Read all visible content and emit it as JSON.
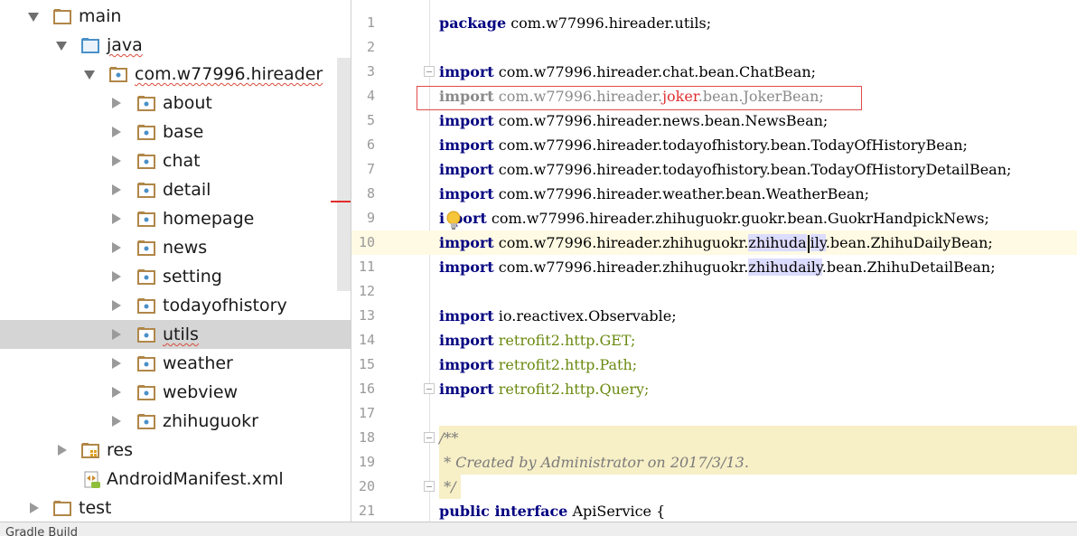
{
  "tree": {
    "nodes": [
      {
        "label": "main",
        "type": "folder",
        "expanded": true
      },
      {
        "label": "java",
        "type": "source-root",
        "expanded": true
      },
      {
        "label": "com.w77996.hireader",
        "type": "package",
        "expanded": true
      },
      {
        "label": "about",
        "type": "package",
        "expanded": false
      },
      {
        "label": "base",
        "type": "package",
        "expanded": false
      },
      {
        "label": "chat",
        "type": "package",
        "expanded": false
      },
      {
        "label": "detail",
        "type": "package",
        "expanded": false
      },
      {
        "label": "homepage",
        "type": "package",
        "expanded": false
      },
      {
        "label": "news",
        "type": "package",
        "expanded": false
      },
      {
        "label": "setting",
        "type": "package",
        "expanded": false
      },
      {
        "label": "todayofhistory",
        "type": "package",
        "expanded": false
      },
      {
        "label": "utils",
        "type": "package",
        "expanded": false,
        "selected": true
      },
      {
        "label": "weather",
        "type": "package",
        "expanded": false
      },
      {
        "label": "webview",
        "type": "package",
        "expanded": false
      },
      {
        "label": "zhihuguokr",
        "type": "package",
        "expanded": false
      },
      {
        "label": "res",
        "type": "resource-folder",
        "expanded": false
      },
      {
        "label": "AndroidManifest.xml",
        "type": "manifest-file"
      },
      {
        "label": "test",
        "type": "folder",
        "expanded": false
      }
    ]
  },
  "bottom_bar": {
    "label": "Gradle Build"
  },
  "editor": {
    "line_numbers": [
      "1",
      "2",
      "3",
      "4",
      "5",
      "6",
      "7",
      "8",
      "9",
      "10",
      "11",
      "12",
      "13",
      "14",
      "15",
      "16",
      "17",
      "18",
      "19",
      "20",
      "21"
    ],
    "current_line": "10",
    "lines": {
      "l1": {
        "kw": "package",
        "rest": " com.w77996.hireader.utils;"
      },
      "l3": {
        "kw": "import",
        "rest": " com.w77996.hireader.chat.bean.ChatBean;"
      },
      "l4": {
        "kw": "import",
        "pre": " com.w77996.hireader.",
        "unresolved": "joker",
        "post": ".bean.JokerBean;"
      },
      "l5": {
        "kw": "import",
        "rest": " com.w77996.hireader.news.bean.NewsBean;"
      },
      "l6": {
        "kw": "import",
        "rest": " com.w77996.hireader.todayofhistory.bean.TodayOfHistoryBean;"
      },
      "l7": {
        "kw": "import",
        "rest": " com.w77996.hireader.todayofhistory.bean.TodayOfHistoryDetailBean;"
      },
      "l8": {
        "kw": "import",
        "rest": " com.w77996.hireader.weather.bean.WeatherBean;"
      },
      "l9": {
        "kw_a": "i",
        "kw_b": "port",
        "rest": " com.w77996.hireader.zhihuguokr.guokr.bean.GuokrHandpickNews;"
      },
      "l10": {
        "kw": "import",
        "pre": " com.w77996.hireader.zhihuguokr.",
        "hl_a": "zhihuda",
        "hl_b": "ily",
        "post": ".bean.ZhihuDailyBean;"
      },
      "l11": {
        "kw": "import",
        "pre": " com.w77996.hireader.zhihuguokr.",
        "hl": "zhihudaily",
        "post": ".bean.ZhihuDetailBean;"
      },
      "l13": {
        "kw": "import",
        "rest": " io.reactivex.Observable;"
      },
      "l14": {
        "kw": "import",
        "rest": " retrofit2.http.GET;"
      },
      "l15": {
        "kw": "import",
        "rest": " retrofit2.http.Path;"
      },
      "l16": {
        "kw": "import",
        "rest": " retrofit2.http.Query;"
      },
      "l18": {
        "text": "/**"
      },
      "l19": {
        "text": " * Created by Administrator on 2017/3/13."
      },
      "l20": {
        "text": " */"
      },
      "l21": {
        "kw": "public interface",
        "rest": " ApiService {"
      }
    }
  },
  "colors": {
    "keyword": "#000080",
    "unresolved": "#e03030",
    "unused_import": "#8a8a8a",
    "unresolved_retrofit": "#6a8a10",
    "comment_bg": "#f7efc6",
    "caret_line": "#fffae3",
    "selection": "#dcdcff"
  }
}
